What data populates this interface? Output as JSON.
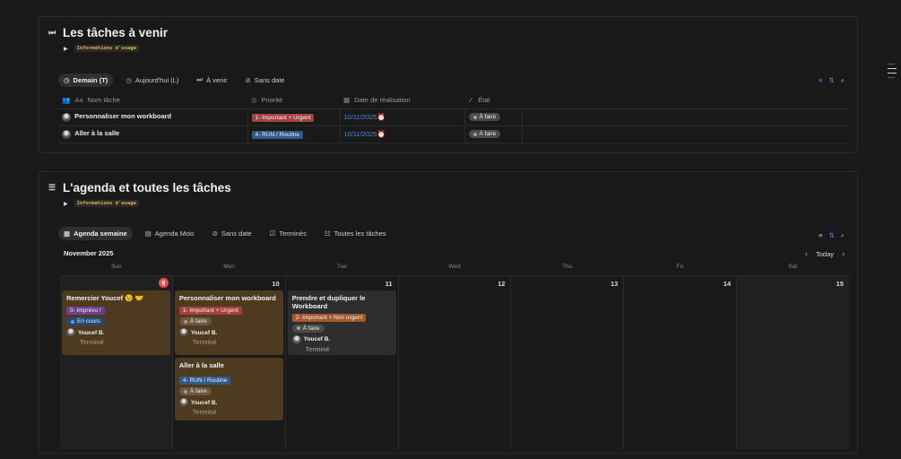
{
  "section1": {
    "title": "Les tâches à venir",
    "usage": "Informations d'usage",
    "tabs": [
      {
        "label": "Demain (T)",
        "icon": "clock-icon"
      },
      {
        "label": "Aujourd'hui (L)",
        "icon": "clock-icon"
      },
      {
        "label": "À venir",
        "icon": "fast-forward-icon"
      },
      {
        "label": "Sans date",
        "icon": "no-date-icon"
      }
    ],
    "columns": [
      "Nom tâche",
      "Priorité",
      "Date de réalisation",
      "État"
    ],
    "rows": [
      {
        "name": "Personnaliser mon workboard",
        "priority": "1- Important + Urgent",
        "date": "10/11/2025",
        "state": "À faire"
      },
      {
        "name": "Aller à la salle",
        "priority": "4- RUN / Routine",
        "date": "10/11/2025",
        "state": "À faire"
      }
    ]
  },
  "section2": {
    "title": "L'agenda et toutes les tâches",
    "usage": "Informations d'usage",
    "tabs": [
      {
        "label": "Agenda semaine",
        "icon": "calendar-icon"
      },
      {
        "label": "Agenda Mois",
        "icon": "calendar-icon"
      },
      {
        "label": "Sans date",
        "icon": "no-date-icon"
      },
      {
        "label": "Terminés",
        "icon": "checkbox-icon"
      },
      {
        "label": "Toutes les tâches",
        "icon": "list-icon"
      }
    ],
    "month": "November 2025",
    "today_label": "Today",
    "weekdays": [
      "Sun",
      "Mon",
      "Tue",
      "Wed",
      "Thu",
      "Fri",
      "Sat"
    ],
    "day_numbers": [
      "9",
      "10",
      "11",
      "12",
      "13",
      "14",
      "15"
    ],
    "cards": {
      "sun": {
        "title": "Remercier Youcef 😉 🤝",
        "tag": "0- Imprévu !",
        "status": "En cours",
        "who": "Youcef B.",
        "done": "Terminé"
      },
      "mon1": {
        "title": "Personnaliser mon workboard",
        "tag": "1- Important + Urgent",
        "status": "À faire",
        "who": "Youcef B.",
        "done": "Terminé"
      },
      "mon2": {
        "title": "Aller à la salle",
        "tag": "4- RUN / Routine",
        "status": "À faire",
        "who": "Youcef B.",
        "done": "Terminé"
      },
      "tue": {
        "title": "Prendre et dupliquer le Workboard",
        "tag": "2- Important + Non urgent",
        "status": "À faire",
        "who": "Youcef B.",
        "done": "Terminé"
      }
    }
  },
  "colors": {
    "accent_blue": "#4a8ad8",
    "today_red": "#e05252",
    "card_brown": "#4e3a1f"
  }
}
